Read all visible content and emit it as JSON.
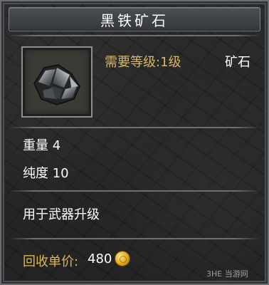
{
  "item": {
    "name": "黑铁矿石",
    "icon": "black-iron-ore-icon",
    "required_level": "需要等级:1级",
    "category": "矿石",
    "weight": "重量 4",
    "purity": "纯度 10",
    "description": "用于武器升级",
    "price_label": "回收单价:",
    "price_value": "480",
    "currency_icon": "gold-coin-icon"
  },
  "watermark": "3HE 当游网",
  "colors": {
    "gold_text": "#d9b65c",
    "white_text": "#ffffff"
  }
}
